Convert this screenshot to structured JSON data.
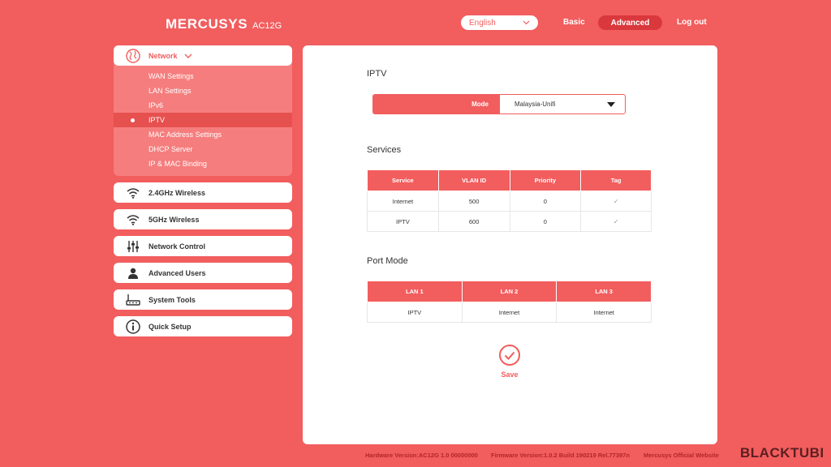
{
  "header": {
    "brand": "MERCUSYS",
    "model": "AC12G",
    "language": "English",
    "nav_basic": "Basic",
    "nav_advanced": "Advanced",
    "nav_logout": "Log out"
  },
  "sidebar": {
    "network": {
      "label": "Network",
      "items": [
        {
          "label": "WAN Settings"
        },
        {
          "label": "LAN Settings"
        },
        {
          "label": "IPv6"
        },
        {
          "label": "IPTV"
        },
        {
          "label": "MAC Address Settings"
        },
        {
          "label": "DHCP Server"
        },
        {
          "label": "IP & MAC Binding"
        }
      ]
    },
    "groups": [
      {
        "label": "2.4GHz Wireless",
        "icon": "wifi-icon"
      },
      {
        "label": "5GHz Wireless",
        "icon": "wifi-icon"
      },
      {
        "label": "Network Control",
        "icon": "sliders-icon"
      },
      {
        "label": "Advanced Users",
        "icon": "user-icon"
      },
      {
        "label": "System Tools",
        "icon": "router-icon"
      },
      {
        "label": "Quick Setup",
        "icon": "info-icon"
      }
    ]
  },
  "main": {
    "iptv_title": "IPTV",
    "mode_label": "Mode",
    "mode_value": "Malaysia-Unifi",
    "services_title": "Services",
    "services_headers": [
      "Service",
      "VLAN ID",
      "Priority",
      "Tag"
    ],
    "services_rows": [
      {
        "service": "Internet",
        "vlan": "500",
        "priority": "0",
        "tag": "✓"
      },
      {
        "service": "IPTV",
        "vlan": "600",
        "priority": "0",
        "tag": "✓"
      }
    ],
    "port_title": "Port Mode",
    "port_headers": [
      "LAN 1",
      "LAN 2",
      "LAN 3"
    ],
    "port_row": [
      "IPTV",
      "Internet",
      "Internet"
    ],
    "save_label": "Save"
  },
  "footer": {
    "hardware": "Hardware Version:AC12G 1.0 00000000",
    "firmware": "Firmware Version:1.0.2 Build 190219 Rel.77397n",
    "website": "Mercusys Official Website"
  },
  "watermark": "BLACKTUBI",
  "colors": {
    "accent": "#f25d5e",
    "accent_dark": "#d9383c"
  }
}
